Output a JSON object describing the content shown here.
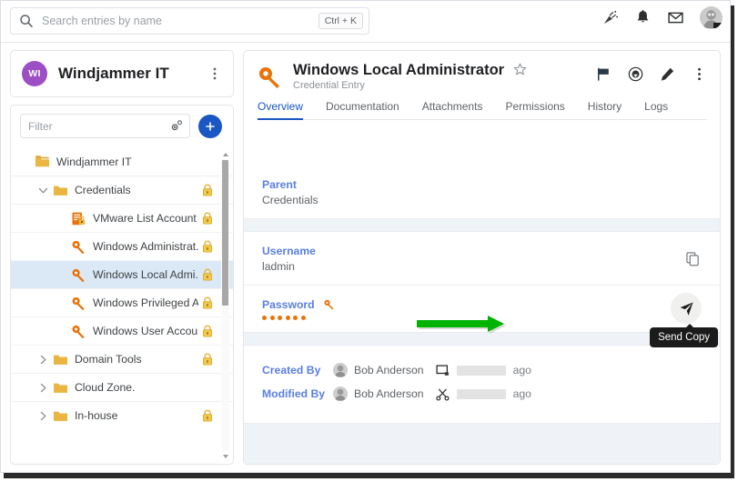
{
  "topbar": {
    "search": {
      "placeholder": "Search entries by name",
      "value": "",
      "shortcut": "Ctrl + K",
      "icon": "search-icon"
    },
    "icons": [
      {
        "name": "announcement-icon",
        "label": "Announcements"
      },
      {
        "name": "bell-icon",
        "label": "Notifications"
      },
      {
        "name": "envelope-icon",
        "label": "Messages"
      }
    ],
    "avatar_alt": "User avatar"
  },
  "sidebar": {
    "org": {
      "initials": "WI",
      "name": "Windjammer IT",
      "menu_icon": "kebab-menu-icon",
      "avatar_color": "#9c4fc4"
    },
    "filter": {
      "placeholder": "Filter",
      "value": "",
      "settings_icon": "gear-icon"
    },
    "add_button": {
      "name": "add-entry-button",
      "glyph": "+"
    },
    "refresh_button": {
      "name": "refresh-icon"
    },
    "tree": [
      {
        "label": "Windjammer IT",
        "icon": "folder-stack-icon",
        "indent": 0,
        "chevron": "none",
        "locked": false,
        "selected": false
      },
      {
        "label": "Credentials",
        "icon": "folder-icon",
        "indent": 1,
        "chevron": "down",
        "locked": true,
        "selected": false
      },
      {
        "label": "VMware List Account",
        "icon": "vmware-list-icon",
        "indent": 2,
        "chevron": "none",
        "locked": true,
        "selected": false
      },
      {
        "label": "Windows Administrat...",
        "icon": "key-icon",
        "indent": 2,
        "chevron": "none",
        "locked": true,
        "selected": false
      },
      {
        "label": "Windows Local Admi...",
        "icon": "key-icon",
        "indent": 2,
        "chevron": "none",
        "locked": true,
        "selected": true
      },
      {
        "label": "Windows Privileged A...",
        "icon": "key-icon",
        "indent": 2,
        "chevron": "none",
        "locked": true,
        "selected": false
      },
      {
        "label": "Windows User Account",
        "icon": "key-icon",
        "indent": 2,
        "chevron": "none",
        "locked": true,
        "selected": false
      },
      {
        "label": "Domain Tools",
        "icon": "folder-icon",
        "indent": 1,
        "chevron": "right",
        "locked": true,
        "selected": false
      },
      {
        "label": "Cloud Zone.",
        "icon": "folder-icon",
        "indent": 1,
        "chevron": "right",
        "locked": false,
        "selected": false
      },
      {
        "label": "In-house",
        "icon": "folder-icon",
        "indent": 1,
        "chevron": "right",
        "locked": true,
        "selected": false
      }
    ]
  },
  "detail": {
    "title": "Windows Local Administrator",
    "subtitle": "Credential Entry",
    "entry_icon": "key-icon",
    "favorite_icon": "star-outline-icon",
    "actions": [
      {
        "name": "flag-icon",
        "label": "Flag"
      },
      {
        "name": "record-icon",
        "label": "Session"
      },
      {
        "name": "edit-pencil-icon",
        "label": "Edit"
      },
      {
        "name": "kebab-menu-icon",
        "label": "More"
      }
    ],
    "tabs": [
      {
        "label": "Overview",
        "active": true
      },
      {
        "label": "Documentation",
        "active": false
      },
      {
        "label": "Attachments",
        "active": false
      },
      {
        "label": "Permissions",
        "active": false
      },
      {
        "label": "History",
        "active": false
      },
      {
        "label": "Logs",
        "active": false
      }
    ],
    "fields": {
      "parent": {
        "label": "Parent",
        "value": "Credentials"
      },
      "username": {
        "label": "Username",
        "value": "ladmin",
        "copy_icon": "copy-icon"
      },
      "password": {
        "label": "Password",
        "masked": "●●●●●●",
        "dot_count": 6,
        "key_icon": "key-icon",
        "send_icon": "send-paper-plane-icon"
      }
    },
    "tooltip": {
      "text": "Send Copy"
    },
    "annotation": {
      "type": "green-arrow",
      "color": "#00b300",
      "points_to": "send-copy-button"
    },
    "meta": [
      {
        "label": "Created By",
        "user": "Bob Anderson",
        "icon": "monitor-icon",
        "value_redacted": true,
        "suffix": "ago"
      },
      {
        "label": "Modified By",
        "user": "Bob Anderson",
        "icon": "share-nodes-icon",
        "value_redacted": true,
        "suffix": "ago"
      }
    ]
  },
  "colors": {
    "accent_blue": "#1a56c4",
    "label_blue": "#5a7fe0",
    "key_orange": "#e8730a",
    "folder_yellow": "#eab540",
    "selected_row": "#dbe9f7",
    "band": "#eff2f7",
    "annotation_green": "#00b300"
  }
}
